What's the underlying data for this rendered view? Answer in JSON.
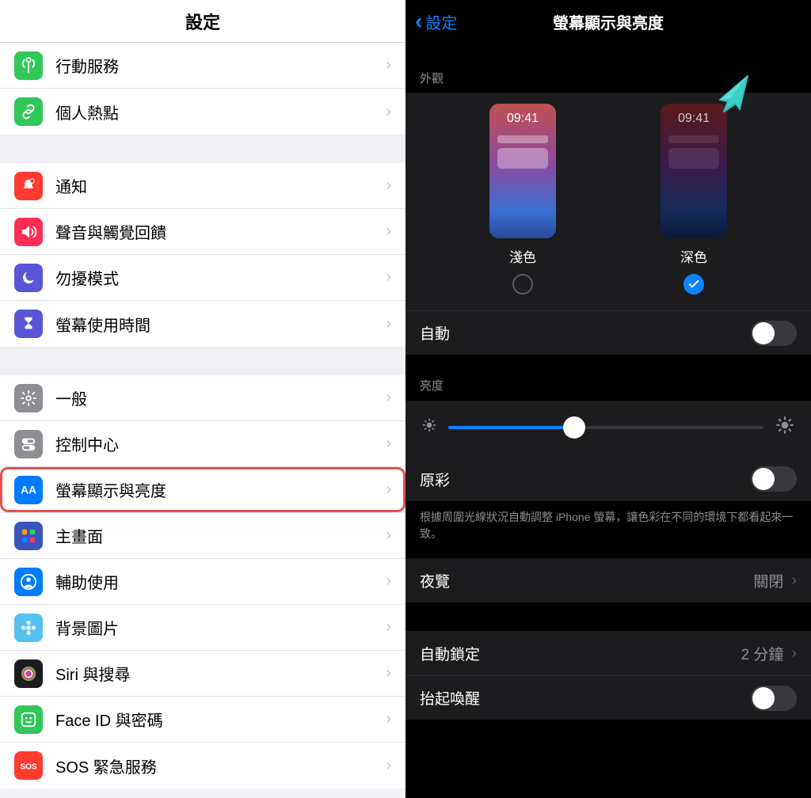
{
  "left": {
    "title": "設定",
    "groups": [
      [
        {
          "id": "cellular",
          "label": "行動服務",
          "icon": "antenna",
          "bg": "#31c859"
        },
        {
          "id": "hotspot",
          "label": "個人熱點",
          "icon": "link",
          "bg": "#31c859"
        }
      ],
      [
        {
          "id": "notifications",
          "label": "通知",
          "icon": "bell-badge",
          "bg": "#ff3b30"
        },
        {
          "id": "sounds",
          "label": "聲音與觸覺回饋",
          "icon": "speaker",
          "bg": "#ff2d55"
        },
        {
          "id": "dnd",
          "label": "勿擾模式",
          "icon": "moon",
          "bg": "#5856d6"
        },
        {
          "id": "screentime",
          "label": "螢幕使用時間",
          "icon": "hourglass",
          "bg": "#5856d6"
        }
      ],
      [
        {
          "id": "general",
          "label": "一般",
          "icon": "gear",
          "bg": "#8e8e93"
        },
        {
          "id": "control-center",
          "label": "控制中心",
          "icon": "switches",
          "bg": "#8e8e93"
        },
        {
          "id": "display",
          "label": "螢幕顯示與亮度",
          "icon": "aa",
          "bg": "#007aff",
          "highlight": true
        },
        {
          "id": "home",
          "label": "主畫面",
          "icon": "grid",
          "bg": "#3955bd"
        },
        {
          "id": "accessibility",
          "label": "輔助使用",
          "icon": "person-circle",
          "bg": "#007aff"
        },
        {
          "id": "wallpaper",
          "label": "背景圖片",
          "icon": "flower",
          "bg": "#54c1ef"
        },
        {
          "id": "siri",
          "label": "Siri 與搜尋",
          "icon": "siri",
          "bg": "#1c1c1e"
        },
        {
          "id": "faceid",
          "label": "Face ID 與密碼",
          "icon": "faceid",
          "bg": "#31c859"
        },
        {
          "id": "sos",
          "label": "SOS 緊急服務",
          "icon": "sos",
          "bg": "#ff3b30"
        }
      ]
    ]
  },
  "right": {
    "back": "設定",
    "title": "螢幕顯示與亮度",
    "appearance": {
      "section_label": "外觀",
      "preview_time": "09:41",
      "light_label": "淺色",
      "dark_label": "深色",
      "selected": "dark"
    },
    "auto_label": "自動",
    "auto_on": false,
    "brightness": {
      "section_label": "亮度",
      "percent": 40
    },
    "true_tone": {
      "label": "原彩",
      "on": false,
      "footnote": "根據周圍光線狀況自動調整 iPhone 螢幕，讓色彩在不同的環境下都看起來一致。"
    },
    "night_shift": {
      "label": "夜覽",
      "value": "關閉"
    },
    "auto_lock": {
      "label": "自動鎖定",
      "value": "2 分鐘"
    },
    "raise_to_wake": {
      "label": "抬起喚醒",
      "on": false
    },
    "colors": {
      "accent": "#0a84ff",
      "arrow": "#3ad0c8"
    }
  }
}
